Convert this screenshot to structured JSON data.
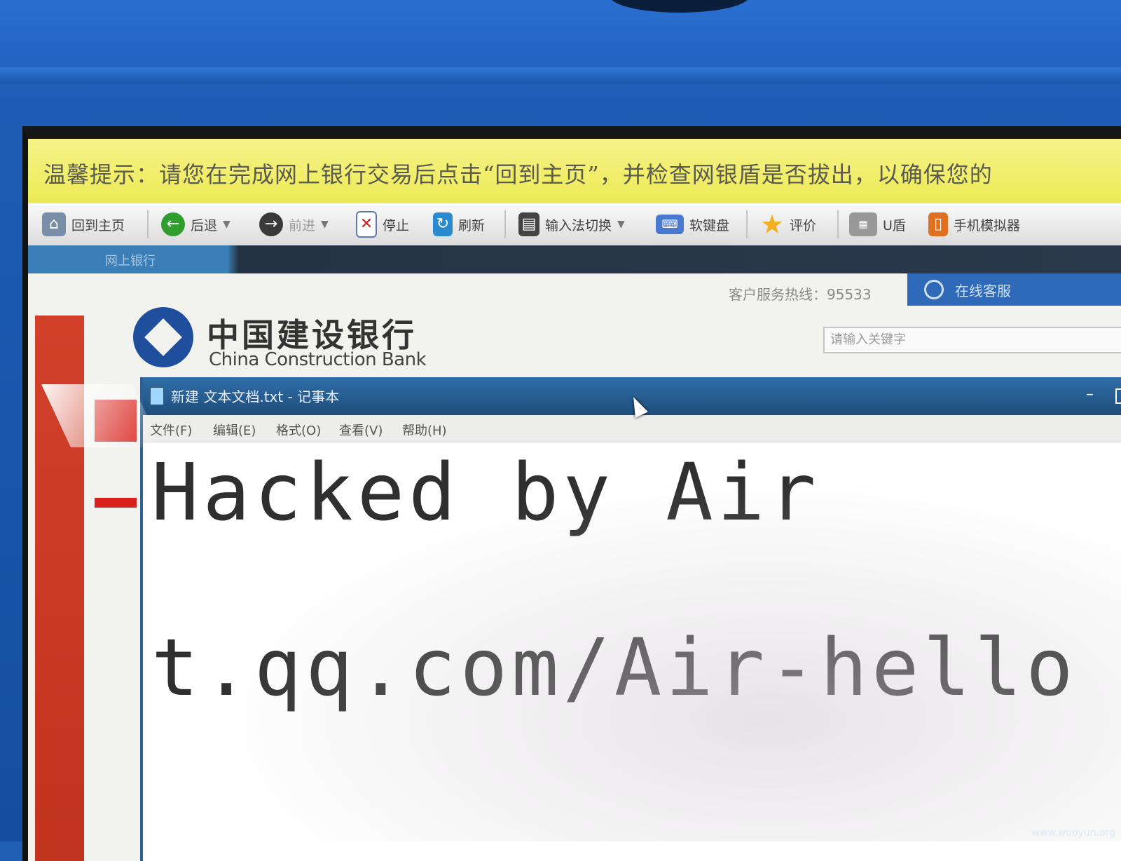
{
  "tip": {
    "text": "温馨提示：请您在完成网上银行交易后点击“回到主页”，并检查网银盾是否拔出，以确保您的"
  },
  "toolbar": {
    "home_label": "回到主页",
    "back_label": "后退",
    "forward_label": "前进",
    "stop_label": "停止",
    "refresh_label": "刷新",
    "ime_label": "输入法切换",
    "keyboard_label": "软键盘",
    "rate_label": "评价",
    "ukey_label": "U盾",
    "phone_label": "手机模拟器"
  },
  "dark_band": {
    "tab_label": "网上银行"
  },
  "bank": {
    "hotline": "客户服务热线：95533",
    "service_label": "在线客服",
    "logo_cn": "中国建设银行",
    "logo_en": "China Construction Bank",
    "search_placeholder": "请输入关键字"
  },
  "notepad": {
    "title": "新建 文本文档.txt - 记事本",
    "menus": [
      "文件(F)",
      "编辑(E)",
      "格式(O)",
      "查看(V)",
      "帮助(H)"
    ],
    "lines": [
      "Hacked by Air",
      "t.qq.com/Air-hello"
    ]
  },
  "watermark": "www.wooyun.org",
  "colors": {
    "bezel": "#1d5cb6",
    "tip_bar": "#ecea55",
    "bank_blue": "#1f4f9c",
    "service_blue": "#2f6ab8",
    "notepad_title": "#1f4d7c"
  }
}
